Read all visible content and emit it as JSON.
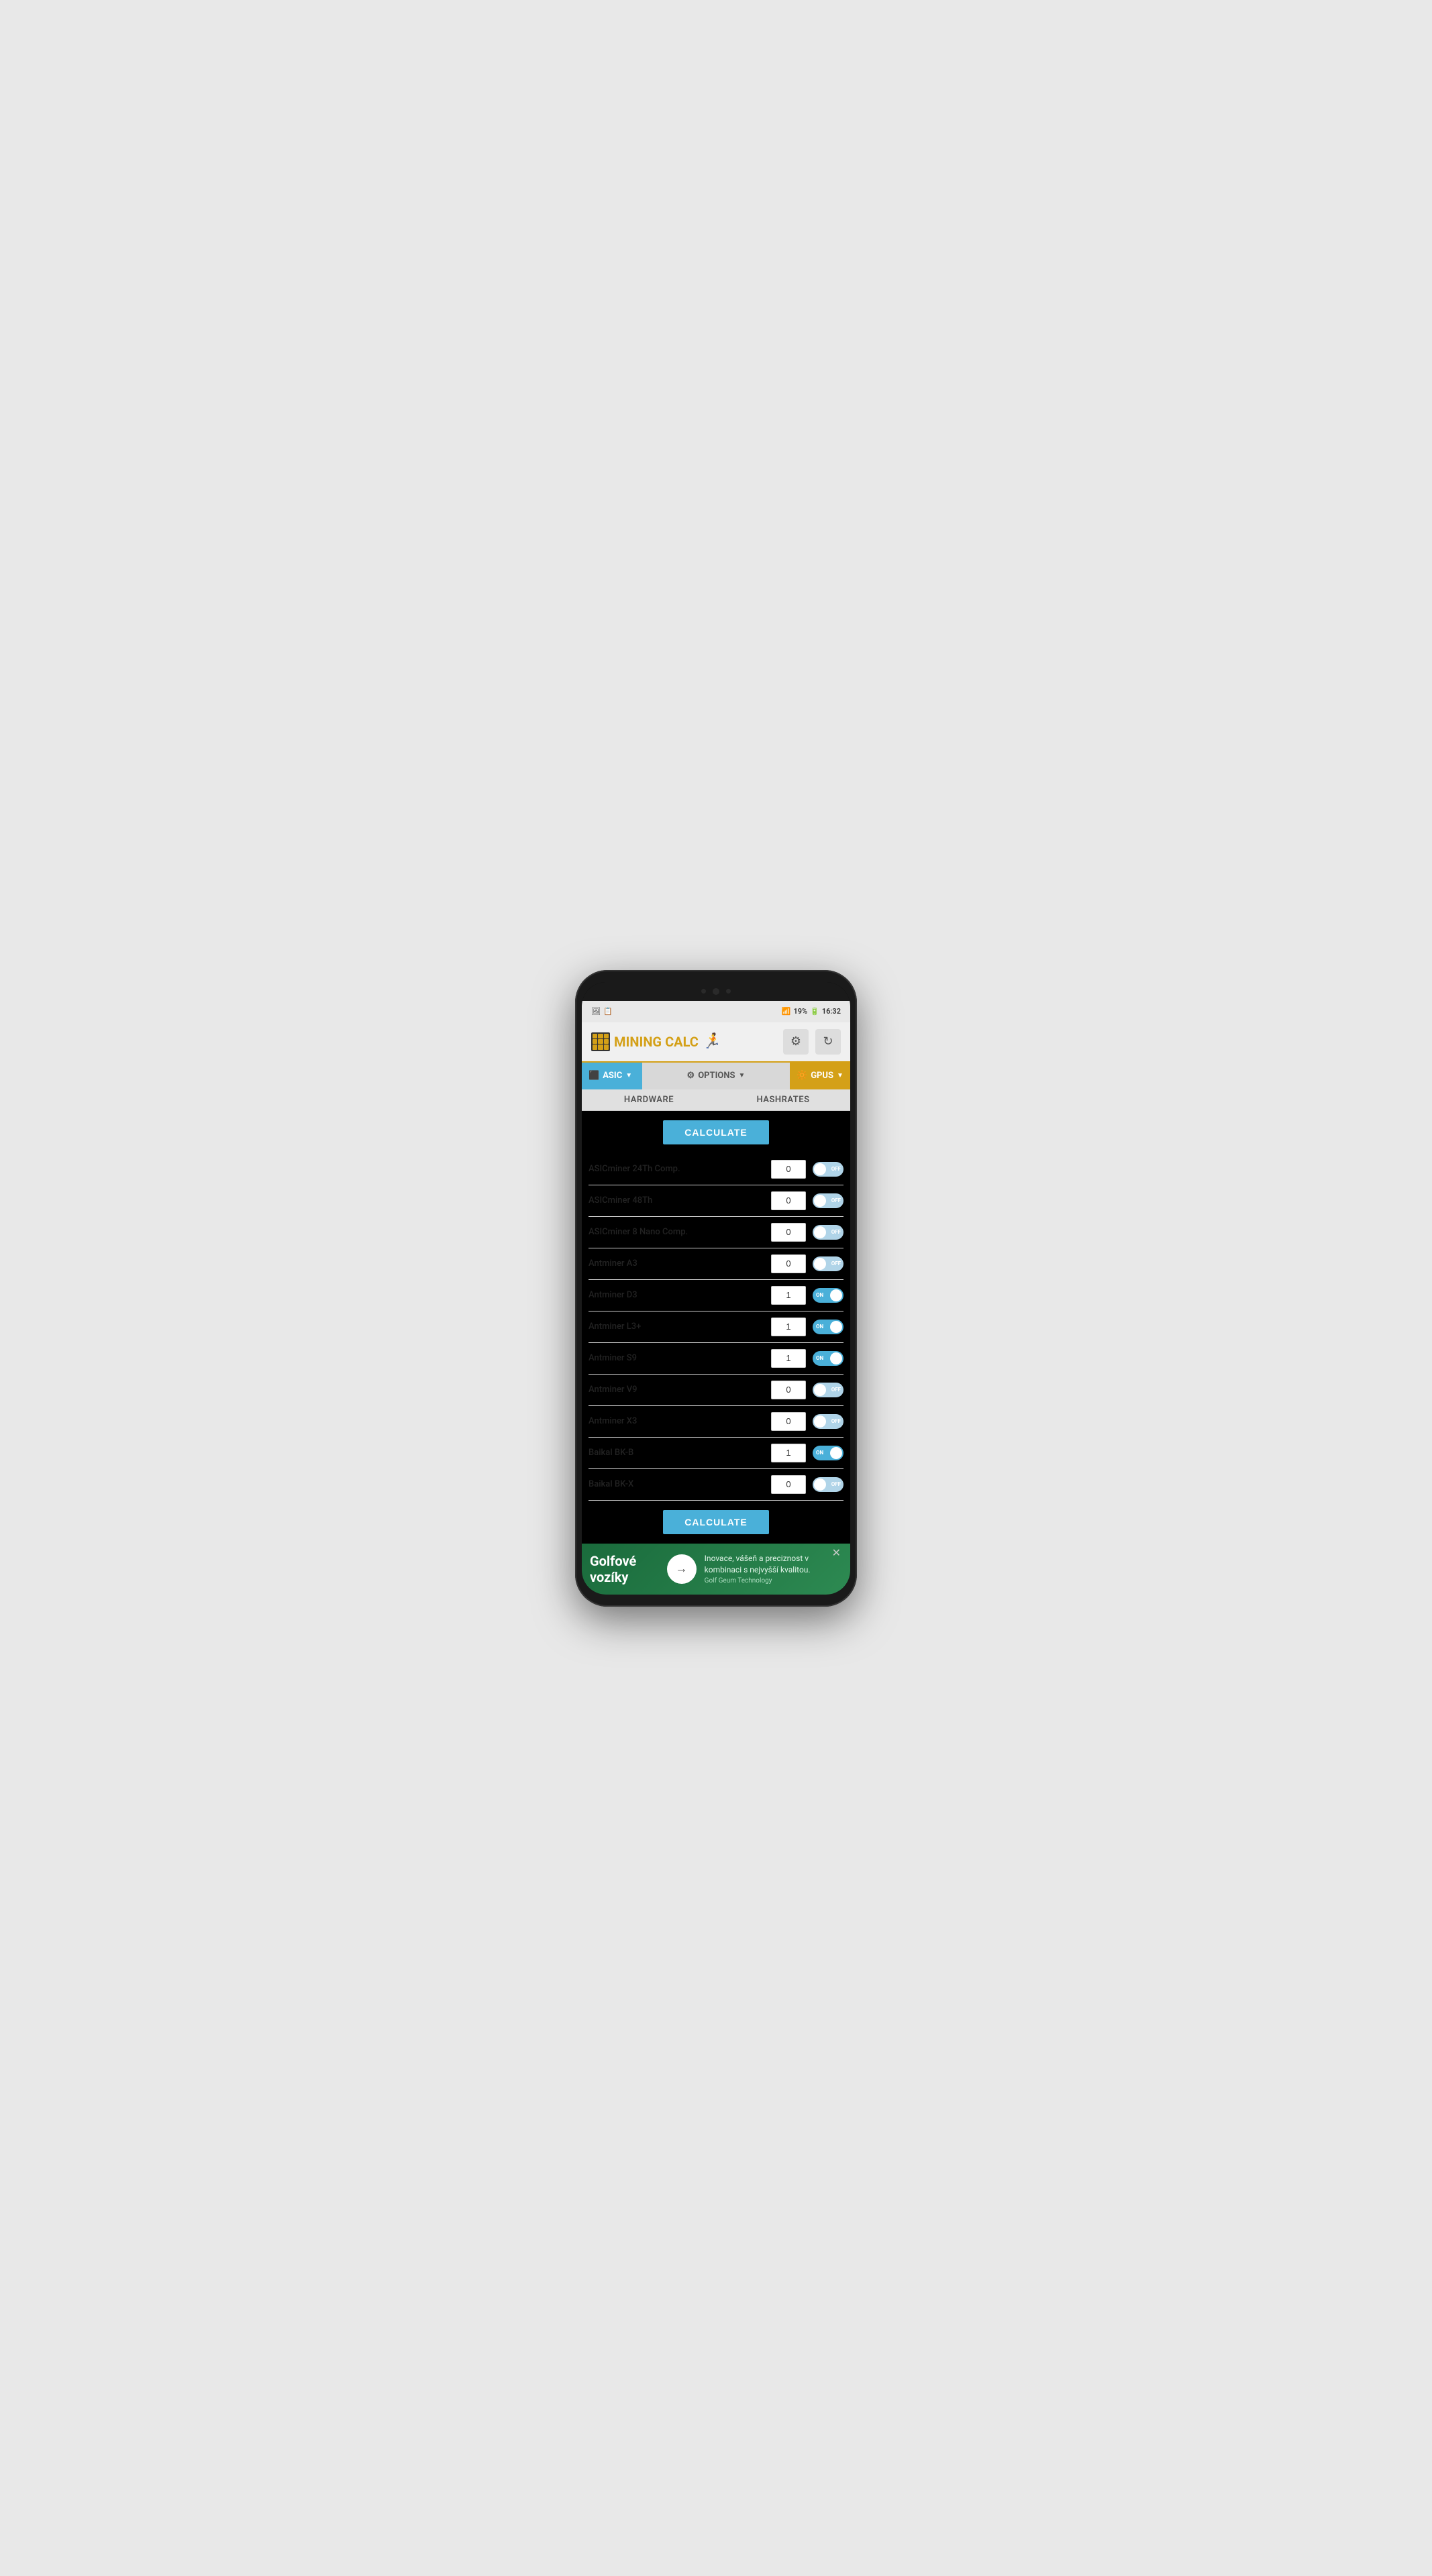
{
  "phone": {
    "status_bar": {
      "battery": "19%",
      "time": "16:32",
      "signal": "WiFi"
    }
  },
  "header": {
    "logo_text_1": "MINING",
    "logo_text_2": "CALC",
    "settings_label": "⚙",
    "refresh_label": "↻"
  },
  "nav": {
    "asic_label": "ASIC",
    "options_label": "OPTIONS",
    "gpus_label": "GPUS"
  },
  "tabs": {
    "hardware_label": "HARDWARE",
    "hashrates_label": "HASHRATES"
  },
  "calculate_top": "CALCULATE",
  "calculate_bottom": "CALCULATE",
  "miners": [
    {
      "name": "ASICminer 24Th Comp.",
      "value": "0",
      "on": false
    },
    {
      "name": "ASICminer 48Th",
      "value": "0",
      "on": false
    },
    {
      "name": "ASICminer 8 Nano Comp.",
      "value": "0",
      "on": false
    },
    {
      "name": "Antminer A3",
      "value": "0",
      "on": false
    },
    {
      "name": "Antminer D3",
      "value": "1",
      "on": true
    },
    {
      "name": "Antminer L3+",
      "value": "1",
      "on": true
    },
    {
      "name": "Antminer S9",
      "value": "1",
      "on": true
    },
    {
      "name": "Antminer V9",
      "value": "0",
      "on": false
    },
    {
      "name": "Antminer X3",
      "value": "0",
      "on": false
    },
    {
      "name": "Baikal BK-B",
      "value": "1",
      "on": true
    },
    {
      "name": "Baikal BK-X",
      "value": "0",
      "on": false
    }
  ],
  "ad": {
    "title": "Golfové vozíky",
    "description": "Inovace, vášeň a preciznost v kombinaci s nejvyšší kvalitou.",
    "company": "Golf Geum Technology",
    "arrow": "→"
  }
}
